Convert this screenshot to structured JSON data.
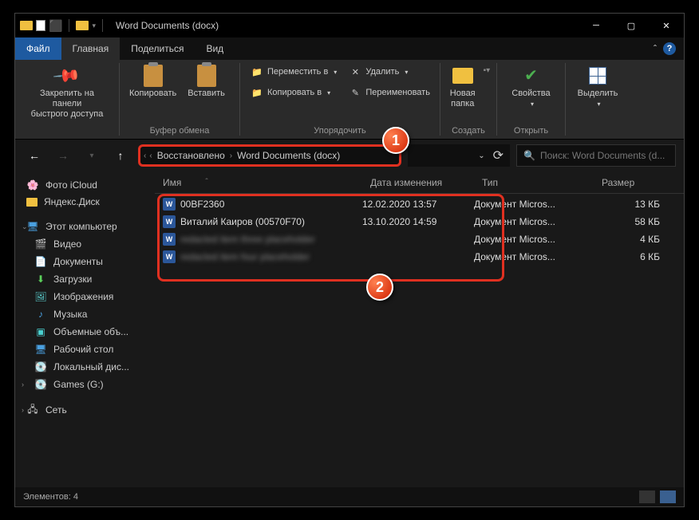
{
  "title": "Word Documents (docx)",
  "tabs": {
    "file": "Файл",
    "home": "Главная",
    "share": "Поделиться",
    "view": "Вид"
  },
  "ribbon": {
    "pin": "Закрепить на панели\nбыстрого доступа",
    "copy": "Копировать",
    "paste": "Вставить",
    "g1": "Буфер обмена",
    "moveTo": "Переместить в",
    "copyTo": "Копировать в",
    "delete": "Удалить",
    "rename": "Переименовать",
    "g2": "Упорядочить",
    "newFolder": "Новая\nпапка",
    "g3": "Создать",
    "properties": "Свойства",
    "g4": "Открыть",
    "select": "Выделить",
    "g5": ""
  },
  "breadcrumb": {
    "p1": "Восстановлено",
    "p2": "Word Documents (docx)"
  },
  "search_placeholder": "Поиск: Word Documents (d...",
  "sidebar": {
    "icloud": "Фото iCloud",
    "yadisk": "Яндекс.Диск",
    "thispc": "Этот компьютер",
    "video": "Видео",
    "docs": "Документы",
    "downloads": "Загрузки",
    "pictures": "Изображения",
    "music": "Музыка",
    "volumes": "Объемные объ...",
    "desktop": "Рабочий стол",
    "localdisk": "Локальный дис...",
    "games": "Games (G:)",
    "network": "Сеть"
  },
  "cols": {
    "name": "Имя",
    "date": "Дата изменения",
    "type": "Тип",
    "size": "Размер"
  },
  "files": [
    {
      "name": "00BF2360",
      "date": "12.02.2020 13:57",
      "type": "Документ Micros...",
      "size": "13 КБ"
    },
    {
      "name": "Виталий Каиров (00570F70)",
      "date": "13.10.2020 14:59",
      "type": "Документ Micros...",
      "size": "58 КБ"
    },
    {
      "name": "redacted item three placeholder",
      "date": "",
      "type": "Документ Micros...",
      "size": "4 КБ"
    },
    {
      "name": "redacted item four placeholder",
      "date": "",
      "type": "Документ Micros...",
      "size": "6 КБ"
    }
  ],
  "status": "Элементов: 4",
  "callouts": {
    "c1": "1",
    "c2": "2"
  }
}
